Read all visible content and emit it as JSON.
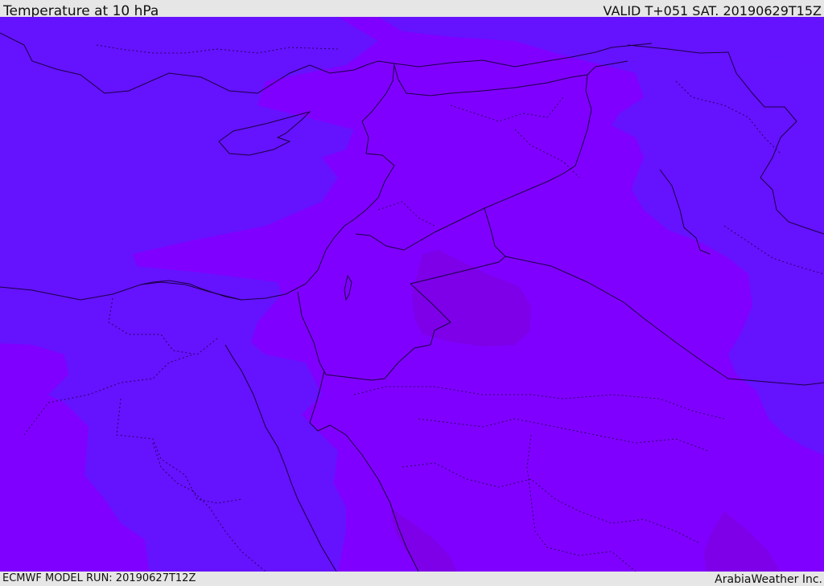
{
  "header": {
    "title": "Temperature at 10 hPa",
    "valid": "VALID T+051 SAT. 20190629T15Z"
  },
  "footer": {
    "model_run": "ECMWF MODEL RUN: 20190627T12Z",
    "credit": "ArabiaWeather Inc."
  },
  "map": {
    "colors": {
      "cooler_band": "#6512ff",
      "mid_band": "#8000ff",
      "warm_band": "#7d00e8",
      "outlines": "#1a0040"
    }
  }
}
